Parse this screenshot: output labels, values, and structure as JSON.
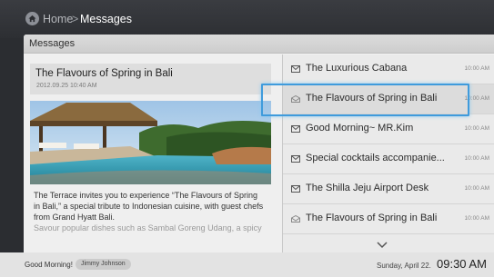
{
  "breadcrumb": {
    "home": "Home",
    "separator": ">",
    "current": "Messages"
  },
  "panel": {
    "title": "Messages"
  },
  "detail": {
    "title": "The Flavours of Spring in Bali",
    "date": "2012.09.25 10:40 AM",
    "body": [
      "The Terrace invites you to experience “The Flavours of Spring",
      "in Bali,” a special tribute to Indonesian cuisine, with guest chefs",
      "from Grand Hyatt Bali.",
      "Savour popular dishes such as Sambal Goreng Udang, a spicy"
    ]
  },
  "messages": [
    {
      "subject": "The Luxurious Cabana",
      "time": "10:00 AM",
      "read": false
    },
    {
      "subject": "The Flavours of Spring in Bali",
      "time": "10:00 AM",
      "read": true,
      "selected": true
    },
    {
      "subject": "Good Morning~ MR.Kim",
      "time": "10:00 AM",
      "read": false
    },
    {
      "subject": "Special cocktails accompanie...",
      "time": "10:00 AM",
      "read": false
    },
    {
      "subject": "The Shilla Jeju Airport Desk",
      "time": "10:00 AM",
      "read": false
    },
    {
      "subject": "The Flavours of Spring in Bali",
      "time": "10:00 AM",
      "read": true
    }
  ],
  "status": {
    "greeting": "Good Morning!",
    "user": "Jimmy Johnson",
    "date": "Sunday, April 22.",
    "time": "09:30 AM"
  },
  "icons": {
    "home": "home-icon",
    "mail_unread": "envelope-icon",
    "mail_read": "envelope-open-icon",
    "more": "chevron-down-icon"
  },
  "colors": {
    "selection": "#3f9bdc"
  }
}
